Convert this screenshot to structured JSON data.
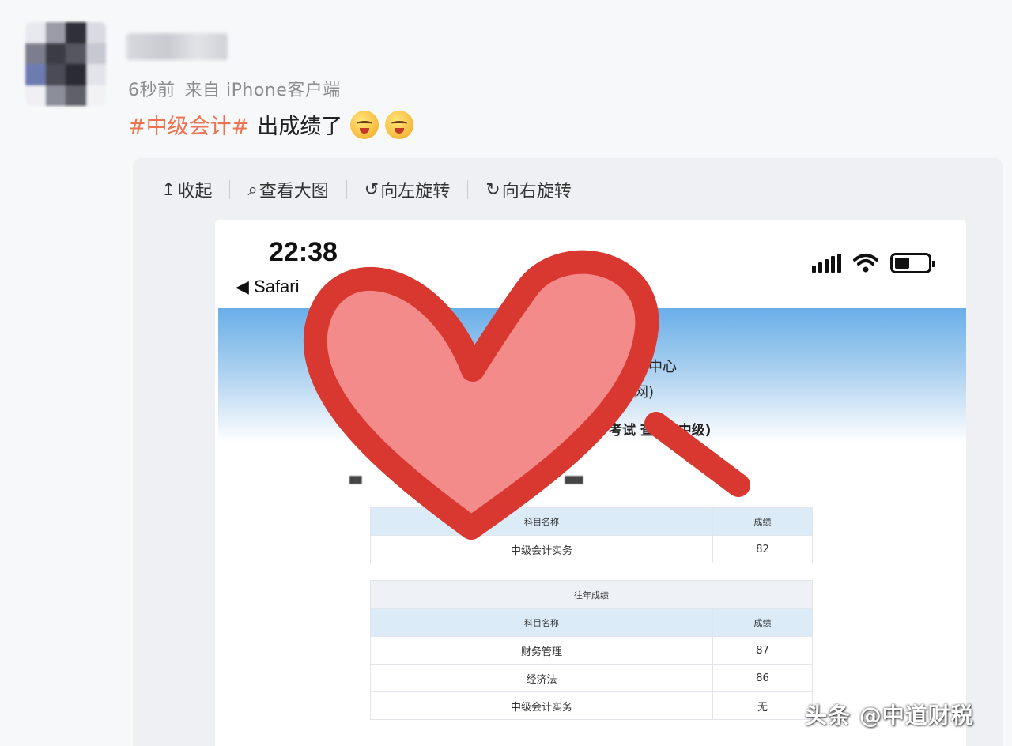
{
  "post": {
    "meta_time": "6秒前",
    "meta_source": "来自 iPhone客户端",
    "hashtag": "#中级会计#",
    "text": "出成绩了",
    "emoji_names": [
      "sly-smile-emoji",
      "sly-smile-emoji"
    ]
  },
  "toolbar": {
    "collapse": "收起",
    "view_large": "查看大图",
    "rotate_left": "向左旋转",
    "rotate_right": "向右旋转"
  },
  "photo": {
    "status_time": "22:38",
    "status_back": "◀ Safari",
    "banner_line1": "中心",
    "banner_line2": "网)",
    "page_title": "考试 查询 (中级)",
    "table1": {
      "headers": [
        "科目名称",
        "成绩"
      ],
      "rows": [
        [
          "中级会计实务",
          "82"
        ]
      ]
    },
    "table2": {
      "caption": "往年成绩",
      "headers": [
        "科目名称",
        "成绩"
      ],
      "rows": [
        [
          "财务管理",
          "87"
        ],
        [
          "经济法",
          "86"
        ],
        [
          "中级会计实务",
          "无"
        ]
      ]
    }
  },
  "watermark": "头条 @中道财税",
  "colors": {
    "hashtag": "#eb7350",
    "heart_fill": "#f48b8b",
    "heart_stroke": "#d8382f",
    "banner_top": "#6aaee9"
  }
}
